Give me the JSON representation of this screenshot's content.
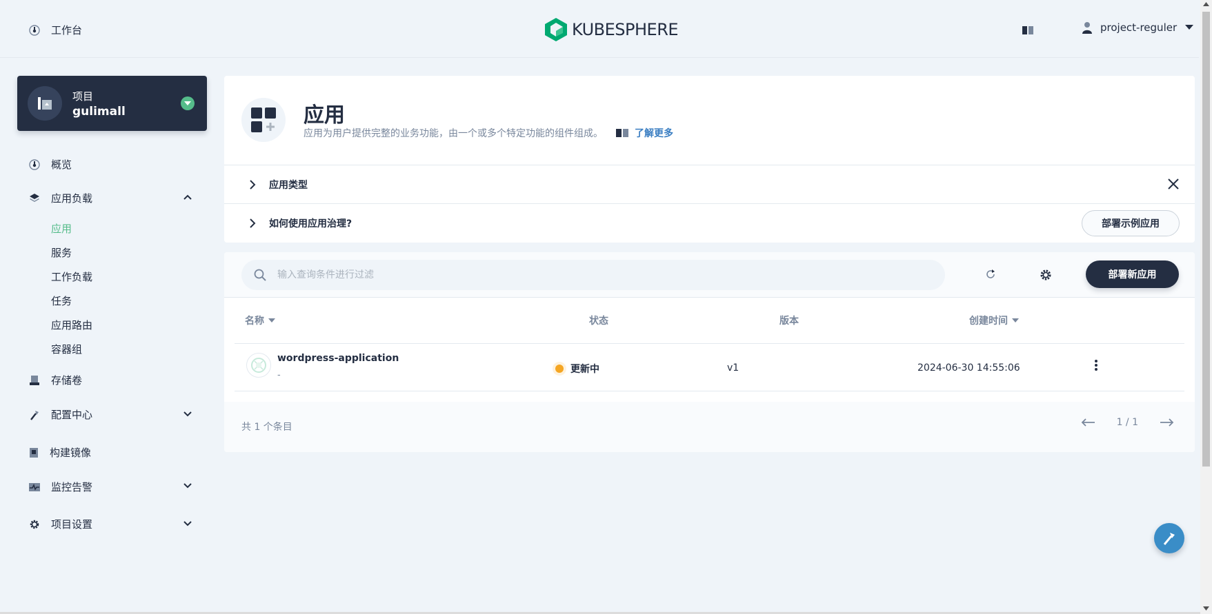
{
  "topbar": {
    "workbench_label": "工作台",
    "logo_text": "KUBESPHERE",
    "username": "project-reguler"
  },
  "project": {
    "type_label": "项目",
    "name": "gulimall"
  },
  "sidebar": {
    "overview": "概览",
    "workloads_group": "应用负载",
    "sub_items": [
      "应用",
      "服务",
      "工作负载",
      "任务",
      "应用路由",
      "容器组"
    ],
    "storage": "存储卷",
    "config": "配置中心",
    "images": "构建镜像",
    "monitoring": "监控告警",
    "settings": "项目设置"
  },
  "hero": {
    "title": "应用",
    "description": "应用为用户提供完整的业务功能，由一个或多个特定功能的组件组成。",
    "learn_more": "了解更多"
  },
  "collapsibles": {
    "app_types": "应用类型",
    "how_to": "如何使用应用治理?",
    "deploy_sample": "部署示例应用"
  },
  "list": {
    "search_placeholder": "输入查询条件进行过滤",
    "deploy_new": "部署新应用",
    "columns": {
      "name": "名称",
      "status": "状态",
      "version": "版本",
      "created": "创建时间"
    },
    "rows": [
      {
        "name": "wordpress-application",
        "desc": "-",
        "status": "更新中",
        "version": "v1",
        "created": "2024-06-30 14:55:06"
      }
    ],
    "total": "共 1 个条目",
    "page": "1 / 1"
  },
  "colors": {
    "primary_dark": "#242e42",
    "accent_green": "#55bc8a",
    "status_updating": "#f5a623",
    "link": "#3a7ec2"
  }
}
